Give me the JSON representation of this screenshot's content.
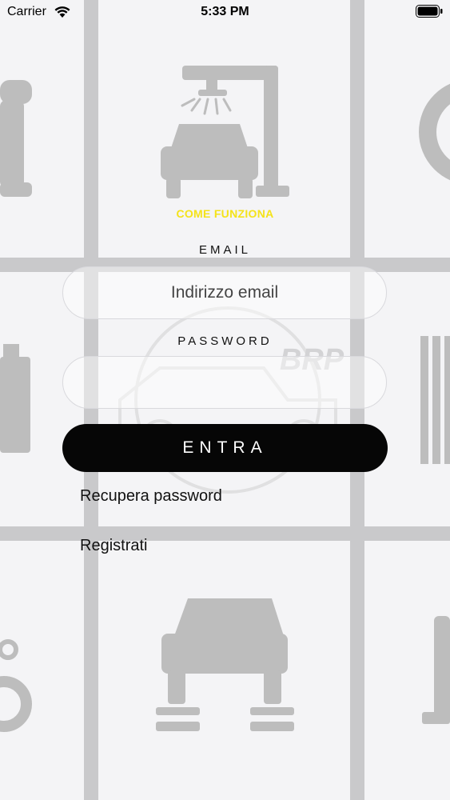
{
  "status_bar": {
    "carrier": "Carrier",
    "time": "5:33 PM"
  },
  "link_how_it_works": "COME FUNZIONA",
  "email": {
    "label": "EMAIL",
    "placeholder": "Indirizzo email",
    "value": ""
  },
  "password": {
    "label": "PASSWORD",
    "value": ""
  },
  "login_button": "ENTRA",
  "recover_password": "Recupera password",
  "register": "Registrati",
  "background_logo_text": "BRP",
  "colors": {
    "accent": "#f4e31a",
    "button": "#060606",
    "background": "#f4f4f6",
    "icons": "#bdbdbd"
  }
}
